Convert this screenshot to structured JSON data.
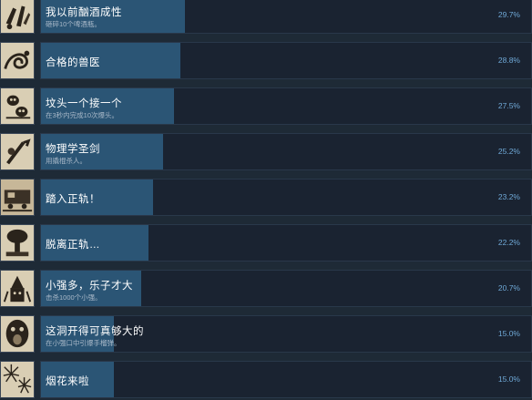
{
  "achievements": [
    {
      "title": "我以前酗酒成性",
      "desc": "砸碎10个啤酒瓶。",
      "percent": "29.7%",
      "progress": 0.297,
      "icon": "bottles-icon"
    },
    {
      "title": "合格的兽医",
      "desc": "",
      "percent": "28.8%",
      "progress": 0.288,
      "icon": "snake-icon"
    },
    {
      "title": "坟头一个接一个",
      "desc": "在3秒内完成10次爆头。",
      "percent": "27.5%",
      "progress": 0.275,
      "icon": "skull-icon"
    },
    {
      "title": "物理学圣剑",
      "desc": "用撬棍杀人。",
      "percent": "25.2%",
      "progress": 0.252,
      "icon": "crowbar-icon"
    },
    {
      "title": "踏入正轨！",
      "desc": "",
      "percent": "23.2%",
      "progress": 0.232,
      "icon": "train-icon"
    },
    {
      "title": "脱离正轨…",
      "desc": "",
      "percent": "22.2%",
      "progress": 0.222,
      "icon": "explosion-icon"
    },
    {
      "title": "小强多，乐子才大",
      "desc": "击杀1000个小强。",
      "percent": "20.7%",
      "progress": 0.207,
      "icon": "zombie-icon"
    },
    {
      "title": "这洞开得可真够大的",
      "desc": "在小强口中引爆手榴弹。",
      "percent": "15.0%",
      "progress": 0.15,
      "icon": "scream-icon"
    },
    {
      "title": "烟花来啦",
      "desc": "",
      "percent": "15.0%",
      "progress": 0.15,
      "icon": "fireworks-icon"
    }
  ]
}
